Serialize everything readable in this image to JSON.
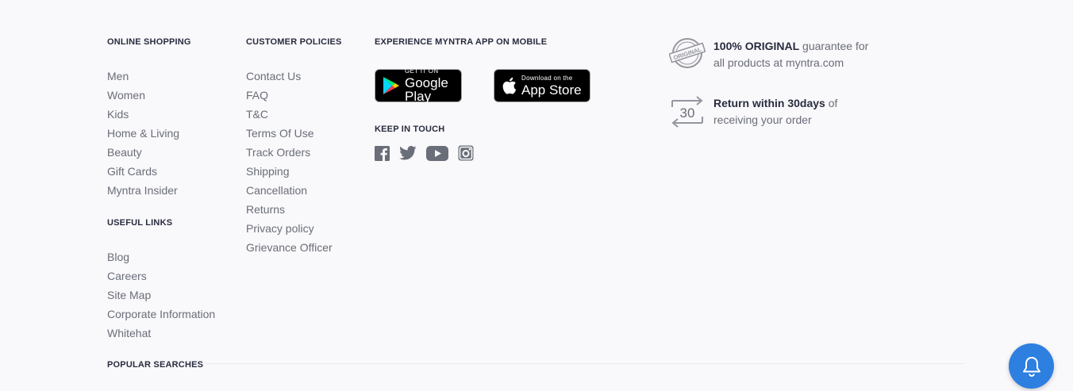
{
  "online_shopping": {
    "heading": "ONLINE SHOPPING",
    "links": [
      "Men",
      "Women",
      "Kids",
      "Home & Living",
      "Beauty",
      "Gift Cards",
      "Myntra Insider"
    ]
  },
  "useful_links": {
    "heading": "USEFUL LINKS",
    "links": [
      "Blog",
      "Careers",
      "Site Map",
      "Corporate Information",
      "Whitehat"
    ]
  },
  "customer_policies": {
    "heading": "CUSTOMER POLICIES",
    "links": [
      "Contact Us",
      "FAQ",
      "T&C",
      "Terms Of Use",
      "Track Orders",
      "Shipping",
      "Cancellation",
      "Returns",
      "Privacy policy",
      "Grievance Officer"
    ]
  },
  "app": {
    "heading": "EXPERIENCE MYNTRA APP ON MOBILE",
    "google_play": {
      "small": "GET IT ON",
      "big": "Google Play"
    },
    "app_store": {
      "small": "Download on the",
      "big": "App Store"
    }
  },
  "keep_in_touch": {
    "heading": "KEEP IN TOUCH",
    "icons": [
      "facebook-icon",
      "twitter-icon",
      "youtube-icon",
      "instagram-icon"
    ]
  },
  "promos": {
    "original": {
      "stamp": "ORIGINAL",
      "bold": "100% ORIGINAL",
      "rest_line1": " guarantee for",
      "line2": "all products at myntra.com"
    },
    "returns": {
      "number": "30",
      "bold": "Return within 30days",
      "rest_line1": " of",
      "line2": "receiving your order"
    }
  },
  "popular_searches": {
    "heading": "POPULAR SEARCHES"
  },
  "colors": {
    "heading": "#282c3f",
    "link": "#696e79",
    "bell": "#2d7fe0",
    "background": "#f9f8fa"
  }
}
